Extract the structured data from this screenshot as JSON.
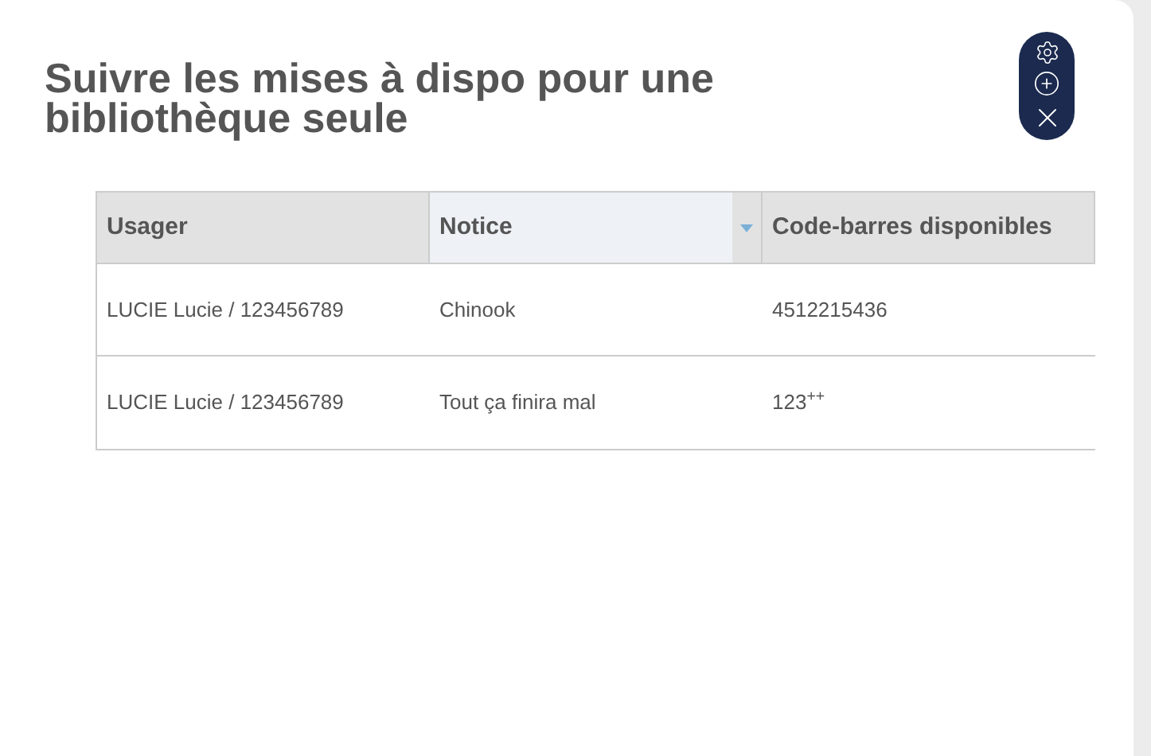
{
  "title": "Suivre les mises à dispo pour une bibliothèque seule",
  "table": {
    "columns": [
      {
        "label": "Usager",
        "sorted": false
      },
      {
        "label": "Notice",
        "sorted": true
      },
      {
        "label": "Code-barres disponibles",
        "sorted": false
      }
    ],
    "rows": [
      [
        "LUCIE Lucie / 123456789",
        "Chinook",
        "4512215436"
      ],
      [
        "LUCIE Lucie / 123456789",
        "Tout ça finira mal",
        "123$^{++}$"
      ]
    ]
  }
}
